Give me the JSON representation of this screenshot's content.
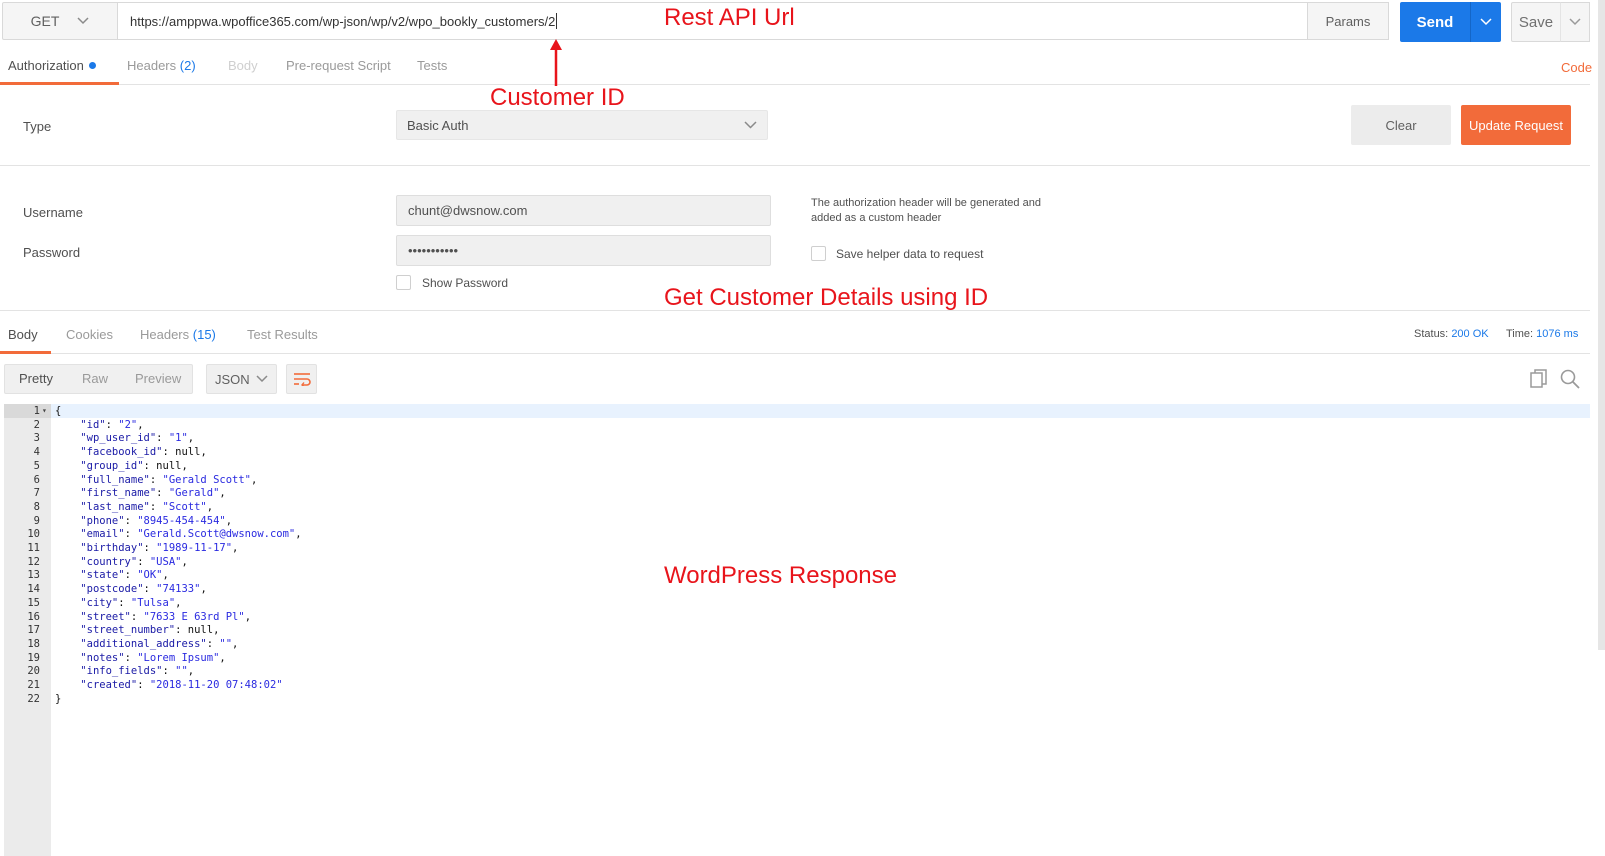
{
  "request": {
    "method": "GET",
    "url": "https://amppwa.wpoffice365.com/wp-json/wp/v2/wpo_bookly_customers/2",
    "params_label": "Params",
    "send_label": "Send",
    "save_label": "Save"
  },
  "request_tabs": [
    {
      "label": "Authorization",
      "active": true
    },
    {
      "label": "Headers",
      "count": "(2)"
    },
    {
      "label": "Body"
    },
    {
      "label": "Pre-request Script"
    },
    {
      "label": "Tests"
    }
  ],
  "code_link": "Code",
  "auth": {
    "type_label": "Type",
    "type_value": "Basic Auth",
    "clear_label": "Clear",
    "update_label": "Update Request",
    "username_label": "Username",
    "username_value": "chunt@dwsnow.com",
    "password_label": "Password",
    "password_value": "•••••••••••",
    "show_password_label": "Show Password",
    "help_text": "The authorization header will be generated and added as a custom header",
    "save_helper_label": "Save helper data to request"
  },
  "response_tabs": [
    {
      "label": "Body",
      "active": true
    },
    {
      "label": "Cookies"
    },
    {
      "label": "Headers",
      "count": "(15)"
    },
    {
      "label": "Test Results"
    }
  ],
  "status": {
    "status_label": "Status:",
    "status_value": "200 OK",
    "time_label": "Time:",
    "time_value": "1076 ms"
  },
  "view": {
    "options": [
      "Pretty",
      "Raw",
      "Preview"
    ],
    "format": "JSON"
  },
  "response_lines": [
    {
      "n": 1,
      "text": "{"
    },
    {
      "n": 2,
      "key": "id",
      "value": "\"2\""
    },
    {
      "n": 3,
      "key": "wp_user_id",
      "value": "\"1\""
    },
    {
      "n": 4,
      "key": "facebook_id",
      "value": "null"
    },
    {
      "n": 5,
      "key": "group_id",
      "value": "null"
    },
    {
      "n": 6,
      "key": "full_name",
      "value": "\"Gerald Scott\""
    },
    {
      "n": 7,
      "key": "first_name",
      "value": "\"Gerald\""
    },
    {
      "n": 8,
      "key": "last_name",
      "value": "\"Scott\""
    },
    {
      "n": 9,
      "key": "phone",
      "value": "\"8945-454-454\""
    },
    {
      "n": 10,
      "key": "email",
      "value": "\"Gerald.Scott@dwsnow.com\""
    },
    {
      "n": 11,
      "key": "birthday",
      "value": "\"1989-11-17\""
    },
    {
      "n": 12,
      "key": "country",
      "value": "\"USA\""
    },
    {
      "n": 13,
      "key": "state",
      "value": "\"OK\""
    },
    {
      "n": 14,
      "key": "postcode",
      "value": "\"74133\""
    },
    {
      "n": 15,
      "key": "city",
      "value": "\"Tulsa\""
    },
    {
      "n": 16,
      "key": "street",
      "value": "\"7633 E 63rd Pl\""
    },
    {
      "n": 17,
      "key": "street_number",
      "value": "null"
    },
    {
      "n": 18,
      "key": "additional_address",
      "value": "\"\""
    },
    {
      "n": 19,
      "key": "notes",
      "value": "\"Lorem Ipsum\""
    },
    {
      "n": 20,
      "key": "info_fields",
      "value": "\"\""
    },
    {
      "n": 21,
      "key": "created",
      "value": "\"2018-11-20 07:48:02\"",
      "last": true
    },
    {
      "n": 22,
      "text": "}"
    }
  ],
  "annotations": {
    "rest_api_url": "Rest API Url",
    "customer_id": "Customer ID",
    "get_details": "Get Customer Details using ID",
    "wp_response": "WordPress Response"
  },
  "colors": {
    "send_blue": "#1b79e8",
    "accent_orange": "#f26b3a",
    "annotation_red": "#e8141b"
  }
}
